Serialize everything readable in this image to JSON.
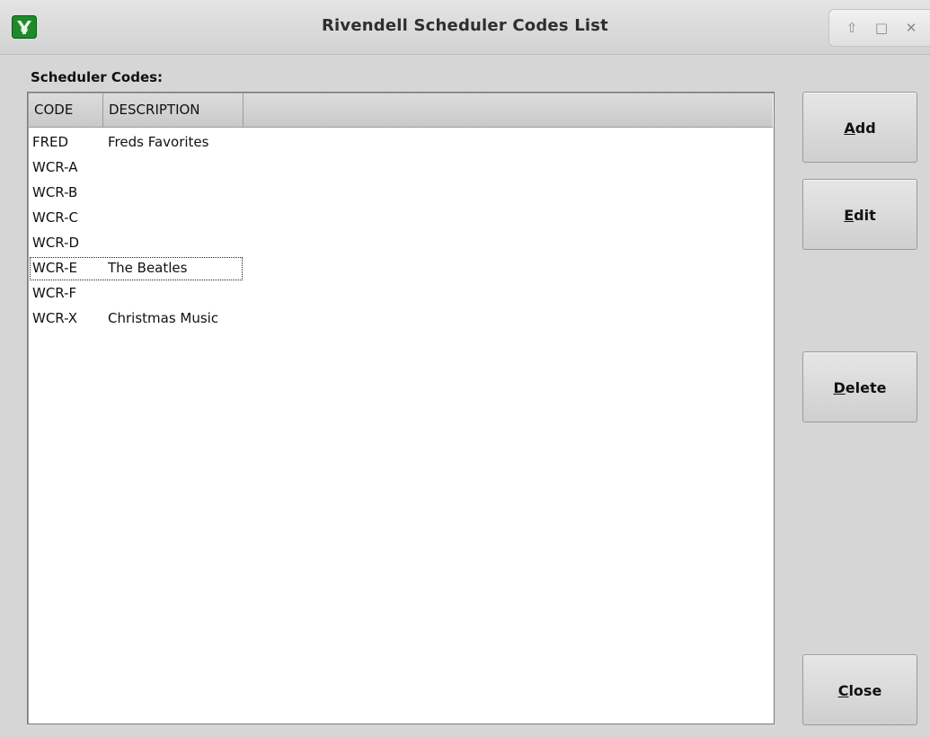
{
  "window": {
    "title": "Rivendell Scheduler Codes List",
    "icon": "rivendell-app-icon",
    "controls": [
      {
        "name": "maximize-icon",
        "glyph": "⇧"
      },
      {
        "name": "restore-icon",
        "glyph": "□"
      },
      {
        "name": "close-window-icon",
        "glyph": "✕"
      }
    ]
  },
  "list": {
    "label": "Scheduler Codes:",
    "columns": [
      "CODE",
      "DESCRIPTION"
    ],
    "rows": [
      {
        "code": "FRED",
        "description": "Freds Favorites"
      },
      {
        "code": "WCR-A",
        "description": ""
      },
      {
        "code": "WCR-B",
        "description": ""
      },
      {
        "code": "WCR-C",
        "description": ""
      },
      {
        "code": "WCR-D",
        "description": ""
      },
      {
        "code": "WCR-E",
        "description": "The Beatles"
      },
      {
        "code": "WCR-F",
        "description": ""
      },
      {
        "code": "WCR-X",
        "description": "Christmas Music"
      }
    ],
    "focused_row": "WCR-E"
  },
  "buttons": {
    "add": {
      "mnemonic": "A",
      "rest": "dd"
    },
    "edit": {
      "mnemonic": "E",
      "rest": "dit"
    },
    "delete": {
      "mnemonic": "D",
      "rest": "elete"
    },
    "close": {
      "mnemonic": "C",
      "rest": "lose"
    }
  },
  "colors": {
    "app_icon": "#1e8a2a",
    "window_bg": "#d6d6d6",
    "list_bg": "#ffffff"
  }
}
